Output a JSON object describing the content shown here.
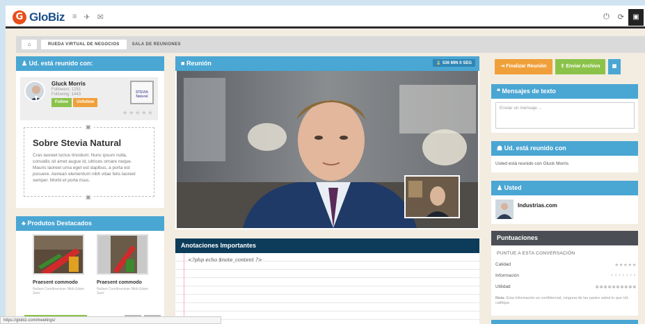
{
  "topbar": {
    "logo_letter": "G",
    "logo_text": "GloBiz",
    "icons": [
      "menu-icon",
      "send-icon",
      "mail-icon"
    ],
    "right_icons": [
      "power-icon",
      "refresh-icon",
      "screen-icon"
    ]
  },
  "breadcrumb": {
    "home_icon": "home-icon",
    "items": [
      "RUEDA VIRTUAL DE NEGOCIOS",
      "SALA DE REUNIONES"
    ]
  },
  "left": {
    "meeting_header": "Ud. está reunido con:",
    "person": {
      "name": "Gluck Morris",
      "followers": "Followers: 1251",
      "following": "Following: 1443",
      "follow_label": "Follow",
      "unfollow_label": "Unfollow",
      "rating": "★★★★★"
    },
    "company_logo_text": "STEVIA Natural",
    "about": {
      "title": "Sobre Stevia Natural",
      "text": "Cras laoreet luctus tincidunt. Nunc ipsum nulla, convallis sit amet augue id, ultrices ornare neque. Mauris laoreet urna eget est dapibus, a porta est posuere. Aenean elementum nibh vitae felis laoreet semper. Morbi et porta risus."
    },
    "products_header": "Produtos Destacados",
    "products": [
      {
        "name": "Praesent commodo",
        "sub": "Nullam Condimentum Nibh Etiam Sem"
      },
      {
        "name": "Praesent commodo",
        "sub": "Nullam Condimentum Nibh Etiam Sem"
      }
    ]
  },
  "center": {
    "meeting_header": "Reunión",
    "timer": "536 MIN 0 SEG",
    "notes_header": "Anotaciones Importantes",
    "notes_placeholder": "<?php echo $note_content ?>"
  },
  "right": {
    "finalize_label": "Finalizar Reunión",
    "send_file_label": "Enviar Archivo",
    "messages_header": "Mensajes de texto",
    "message_placeholder": "Enviar un mensaje ...",
    "met_header": "Ud. está reunido con",
    "met_text": "Usted está reunido con Gluck Morris",
    "you_header": "Usted",
    "you_company": "Industrias.com",
    "scores_header": "Puntuaciones",
    "scores_prompt": "PUNTUE A ESTA CONVERSACIÓN",
    "scores": [
      {
        "label": "Calidad",
        "value": "★★★★★"
      },
      {
        "label": "Información",
        "value": "♆♆♆♆♆♆♆"
      },
      {
        "label": "Utilidad",
        "value": "✱✱✱✱✱✱✱✱✱✱"
      }
    ],
    "note_bold": "Nota:",
    "note_text": "Esta información es confidencial, ninguna de las partes sabrá lo que Ud. califique."
  },
  "statusbar": {
    "url": "https://globiz.com/meetings/"
  },
  "colors": {
    "accent": "#4aa6d3",
    "orange": "#f0a03a",
    "green": "#8bc34a",
    "dark_blue": "#0c3c5a"
  }
}
